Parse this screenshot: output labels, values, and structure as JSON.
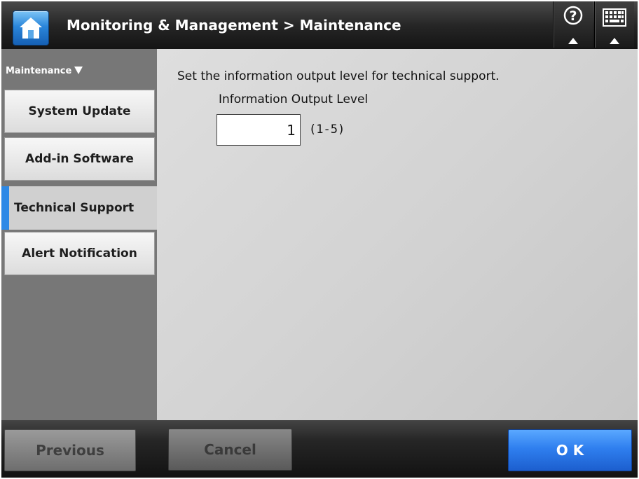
{
  "header": {
    "title": "Monitoring & Management > Maintenance",
    "home_icon": "home-icon",
    "help_icon": "help-icon",
    "keyboard_icon": "keyboard-icon"
  },
  "sidebar": {
    "heading": "Maintenance",
    "items": [
      {
        "label": "System Update"
      },
      {
        "label": "Add-in Software"
      },
      {
        "label": "Technical Support",
        "active": true
      },
      {
        "label": "Alert Notification"
      }
    ]
  },
  "main": {
    "instruction": "Set the information output level for technical support.",
    "field_label": "Information Output Level",
    "field_value": "1",
    "range_hint": "(1-5)"
  },
  "footer": {
    "previous_label": "Previous",
    "cancel_label": "Cancel",
    "ok_label": "O K"
  },
  "colors": {
    "accent_blue": "#2e89e6",
    "ok_button": "#2f7fef",
    "sidebar_bg": "#777777",
    "header_bg": "#262626"
  }
}
